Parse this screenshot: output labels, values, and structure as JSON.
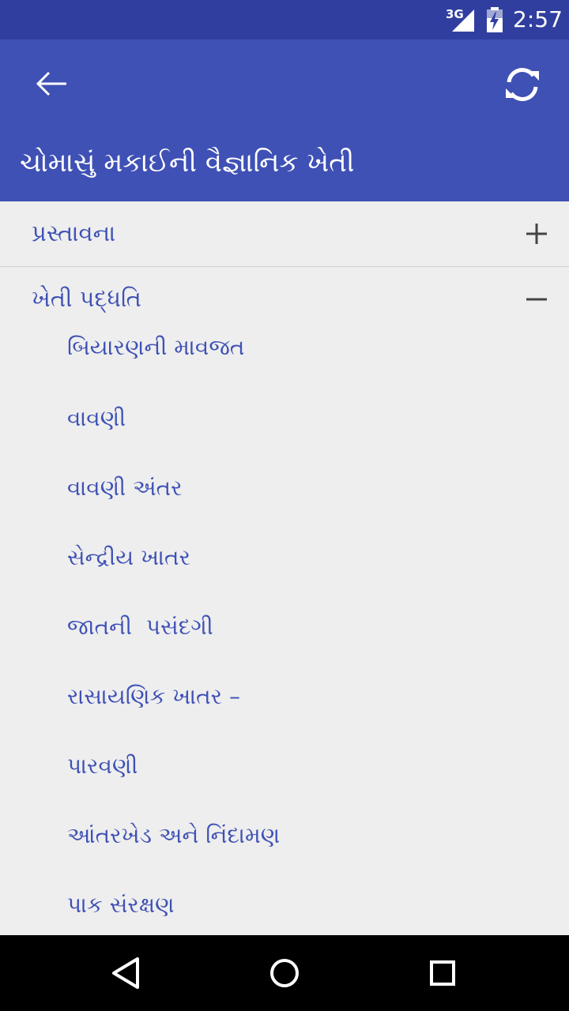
{
  "status_bar": {
    "network": "3G",
    "time": "2:57"
  },
  "app_bar": {
    "title": "ચોમાસું મકાઈની વૈજ્ઞાનિક ખેતી",
    "back_icon": "arrow-left-icon",
    "refresh_icon": "refresh-icon"
  },
  "sections": [
    {
      "label": "પ્રસ્તાવના",
      "state": "collapsed",
      "toggle_icon": "plus-icon"
    },
    {
      "label": "ખેતી પદ્ધતિ",
      "state": "expanded",
      "toggle_icon": "minus-icon",
      "items": [
        "બિયારણની માવજત",
        "વાવણી",
        "વાવણી અંતર",
        "સેન્દ્રીય ખાતર",
        "જાતની  પસંદગી",
        "રાસાયણિક ખાતર –",
        "પારવણી",
        "આંતરખેડ અને નિંદામણ",
        "પાક સંરક્ષણ"
      ]
    }
  ],
  "nav_bar": {
    "back_icon": "triangle-back-icon",
    "home_icon": "circle-home-icon",
    "recents_icon": "square-recents-icon"
  },
  "colors": {
    "primary": "#3f51b5",
    "primary_dark": "#303f9f",
    "background": "#eeeeee"
  }
}
